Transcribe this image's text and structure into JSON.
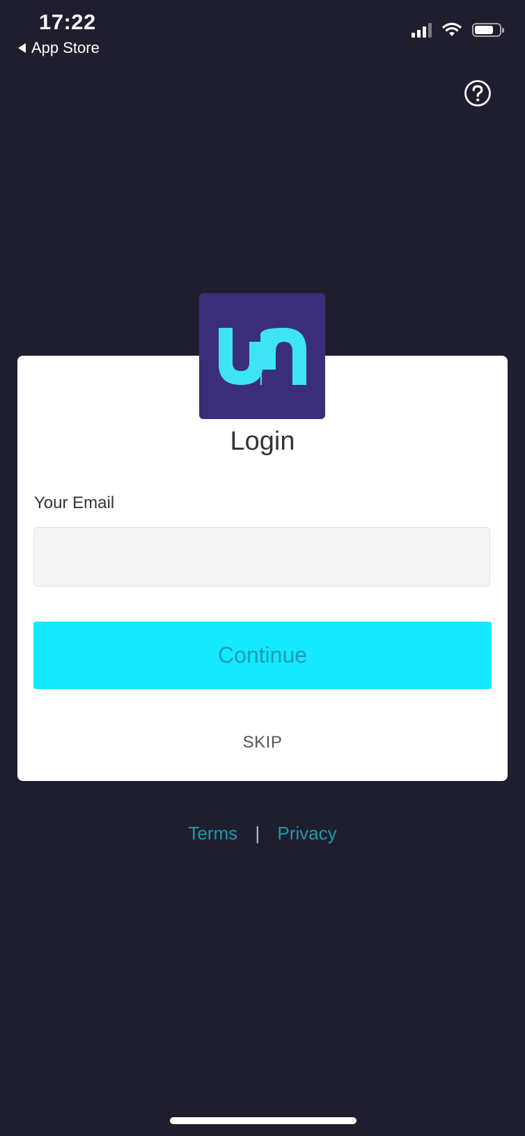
{
  "status_bar": {
    "time": "17:22",
    "back_label": "App Store",
    "battery_level": 0.8
  },
  "icons": {
    "help": "question-circle-icon",
    "back": "back-triangle-icon",
    "signal": "cellular-signal-icon",
    "wifi": "wifi-icon",
    "battery": "battery-icon"
  },
  "login": {
    "title": "Login",
    "email_label": "Your Email",
    "email_value": "",
    "email_placeholder": "",
    "continue_label": "Continue",
    "skip_label": "SKIP"
  },
  "footer": {
    "terms_label": "Terms",
    "separator": "|",
    "privacy_label": "Privacy"
  },
  "colors": {
    "background": "#1f1e2e",
    "accent": "#14e9ff",
    "logo_bg": "#3b2e78",
    "logo_fg": "#3ee4f5",
    "link": "#1a9ab0"
  }
}
